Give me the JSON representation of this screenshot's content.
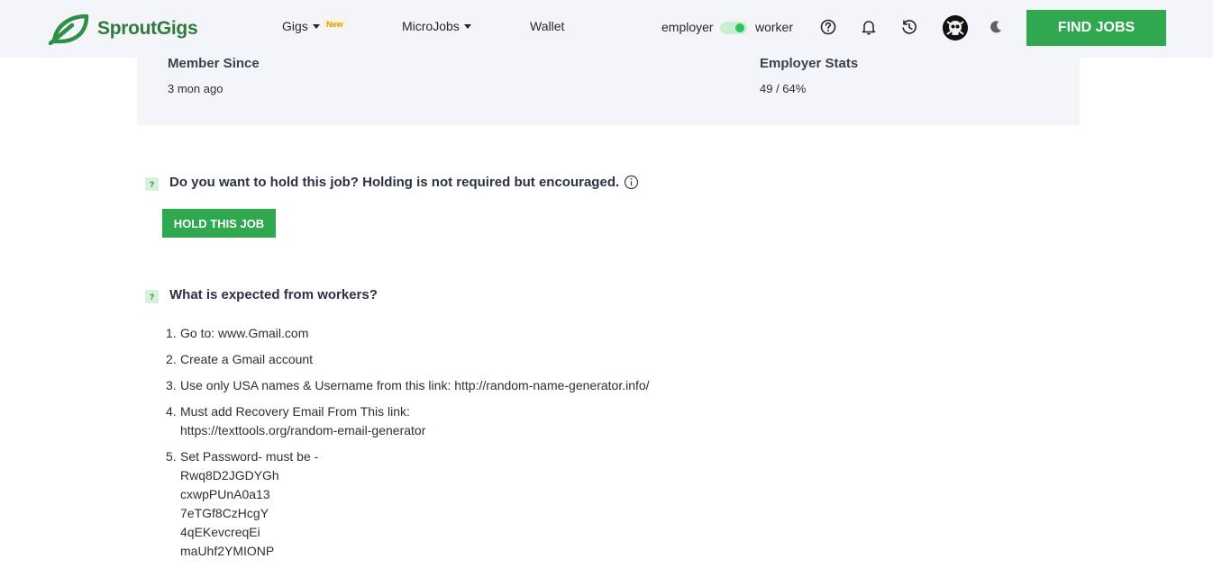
{
  "header": {
    "brand": "SproutGigs",
    "nav": {
      "gigs": "Gigs",
      "gigs_badge": "New",
      "microjobs": "MicroJobs",
      "wallet": "Wallet"
    },
    "role_left": "employer",
    "role_right": "worker",
    "role_toggle_on": true,
    "icons": [
      "help-icon",
      "bell-icon",
      "history-icon",
      "avatar",
      "moon-icon"
    ],
    "find_jobs": "FIND JOBS",
    "accent_color": "#2fa84f"
  },
  "stats": {
    "member_since_label": "Member Since",
    "member_since_value": "3 mon ago",
    "employer_stats_label": "Employer Stats",
    "employer_stats_value": "49 / 64%"
  },
  "hold_section": {
    "badge": "?",
    "question": "Do you want to hold this job? Holding is not required but encouraged.",
    "button": "HOLD THIS JOB"
  },
  "expected_section": {
    "badge": "?",
    "question": "What is expected from workers?",
    "steps": [
      {
        "num": "1.",
        "lines": [
          "Go to: www.Gmail.com"
        ]
      },
      {
        "num": "2.",
        "lines": [
          "Create a Gmail account"
        ]
      },
      {
        "num": "3.",
        "lines": [
          "Use only USA names & Username from this link: http://random-name-generator.info/"
        ]
      },
      {
        "num": "4.",
        "lines": [
          "Must add Recovery Email From This link:",
          "https://texttools.org/random-email-generator"
        ]
      },
      {
        "num": "5.",
        "lines": [
          "Set Password- must be -",
          "Rwq8D2JGDYGh",
          "cxwpPUnA0a13",
          "7eTGf8CzHcgY",
          "4qEKevcreqEi",
          "maUhf2YMIONP"
        ]
      }
    ]
  }
}
